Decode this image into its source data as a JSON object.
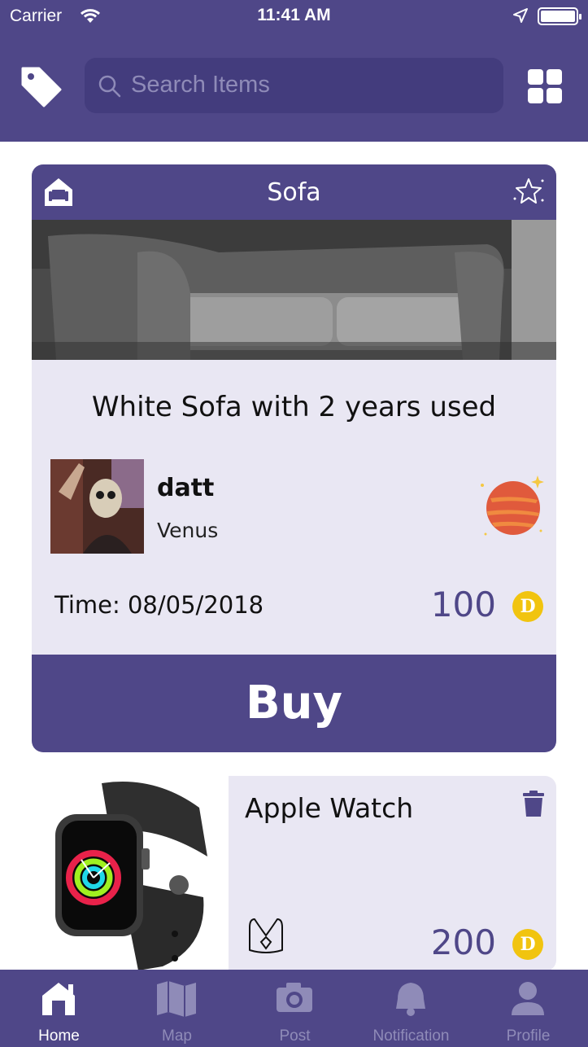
{
  "status_bar": {
    "carrier": "Carrier",
    "time": "11:41 AM"
  },
  "header": {
    "search_placeholder": "Search Items"
  },
  "featured_item": {
    "category": "Sofa",
    "description": "White Sofa with 2 years used",
    "seller_name": "datt",
    "seller_planet": "Venus",
    "time_label": "Time:",
    "time_value": "08/05/2018",
    "price": "100",
    "coin_symbol": "D",
    "buy_label": "Buy"
  },
  "list_items": [
    {
      "title": "Apple Watch",
      "price": "200",
      "coin_symbol": "D"
    }
  ],
  "tab_bar": {
    "tabs": [
      {
        "label": "Home",
        "icon": "home-icon",
        "active": true
      },
      {
        "label": "Map",
        "icon": "map-icon",
        "active": false
      },
      {
        "label": "Post",
        "icon": "camera-icon",
        "active": false
      },
      {
        "label": "Notification",
        "icon": "bell-icon",
        "active": false
      },
      {
        "label": "Profile",
        "icon": "user-icon",
        "active": false
      }
    ]
  },
  "colors": {
    "brand": "#4f4788",
    "card_bg": "#e9e7f3",
    "coin": "#f1c40f"
  }
}
